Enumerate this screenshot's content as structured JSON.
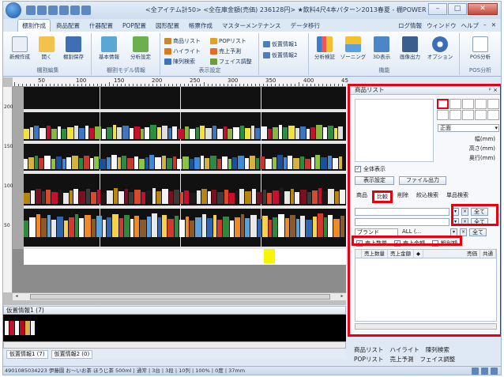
{
  "app": {
    "title": "<全アイテム計50> <全在庫金額(売価) 236128円> ★飲料4尺4本パターン2013春夏 - 棚POWER"
  },
  "window_controls": {
    "min": "–",
    "max": "□",
    "close": "✕"
  },
  "ribbon_tabs": [
    "棚割作成",
    "商品配置",
    "什器配置",
    "POP配置",
    "図形配置",
    "帳票作成",
    "マスターメンテナンス",
    "データ移行"
  ],
  "ribbon_right": [
    "ログ情報",
    "ウィンドウ",
    "ヘルプ",
    "–",
    "✕"
  ],
  "ribbon": {
    "groups": [
      {
        "label": "棚割編集",
        "buttons": [
          "新規作成",
          "開く",
          "棚割保存"
        ]
      },
      {
        "label": "棚割モデル情報",
        "buttons": [
          "基本情報",
          "分析設定"
        ]
      },
      {
        "label": "表示設定",
        "small": [
          "商品リスト",
          "ハイライト",
          "陳列検索",
          "POPリスト",
          "売上予測",
          "フェイス調整"
        ]
      },
      {
        "label": "",
        "small": [
          "仮置情報1",
          "仮置情報2"
        ]
      },
      {
        "label": "機能",
        "buttons": [
          "分析検証",
          "ゾーニング",
          "3D表示",
          "画像出力",
          "オプション"
        ]
      },
      {
        "label": "POS分析",
        "buttons": [
          "POS分析"
        ]
      }
    ]
  },
  "ruler": {
    "h_ticks": [
      "50",
      "100",
      "150",
      "200",
      "250",
      "300",
      "350",
      "400",
      "45"
    ],
    "v_ticks": [
      "200",
      "150",
      "100",
      "50"
    ]
  },
  "bottom": {
    "panel_title": "仮置情報1 (7)",
    "tabs": [
      "仮置情報1 (7)",
      "仮置情報2 (0)"
    ]
  },
  "status": {
    "text": "4901085034223  伊藤園  お〜いお茶  ほうじ茶  500ml  |  通常 | 3台 | 3段 | 10列 | 100% | 0度 | 37mm"
  },
  "product_list": {
    "title": "商品リスト",
    "title_btns": "ᵖ ×",
    "face_select": "正面",
    "dims": [
      "幅(mm)",
      "高さ(mm)",
      "奥行(mm)"
    ],
    "show_all": "全体表示",
    "buttons": {
      "display_settings": "表示設定",
      "file_output": "ファイル出力"
    },
    "tabs": [
      "商品",
      "比較",
      "削除",
      "絞込検索",
      "単品検索"
    ],
    "filters": [
      {
        "label": "",
        "btn": "全て"
      },
      {
        "label": "",
        "btn": "全て"
      },
      {
        "label": "ブランド",
        "value": "ALL (...",
        "btn": "全て"
      }
    ],
    "checks": [
      {
        "label": "売上数量",
        "checked": true
      },
      {
        "label": "売上金額",
        "checked": true
      },
      {
        "label": "粗利額",
        "checked": false
      }
    ],
    "grid_headers": [
      "売上数量",
      "売上金額",
      "◆",
      "売価",
      "共通"
    ],
    "bottom_tabs_row1": [
      "商品リスト",
      "ハイライト",
      "陳列検索"
    ],
    "bottom_tabs_row2": [
      "POPリスト",
      "売上予測",
      "フェイス調整"
    ]
  },
  "colors": {
    "highlight_red": "#e60012",
    "shelf_yellow": "#f6f600"
  }
}
